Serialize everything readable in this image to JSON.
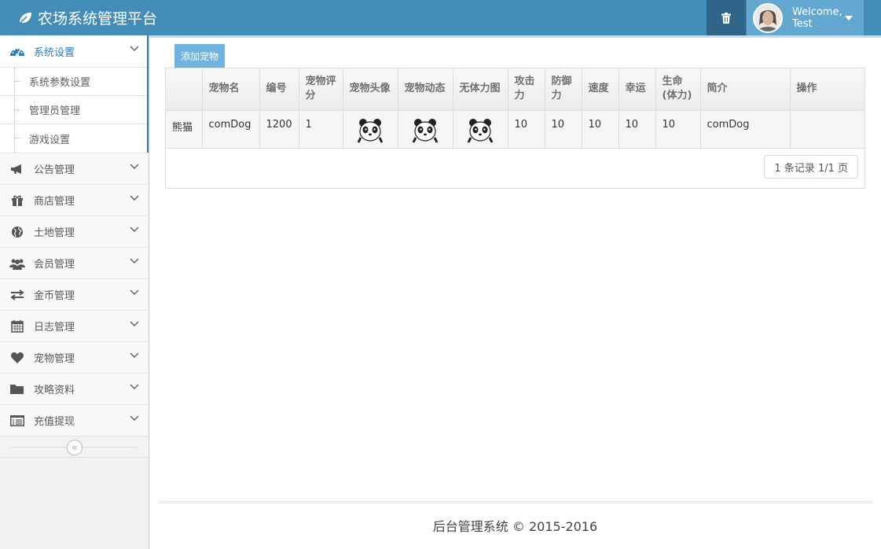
{
  "app": {
    "title": "农场系统管理平台"
  },
  "header": {
    "welcome": "Welcome,",
    "user_name": "Test"
  },
  "sidebar": {
    "items": [
      {
        "label": "系统设置",
        "icon": "dashboard-icon",
        "active": true,
        "children": [
          "系统参数设置",
          "管理员管理",
          "游戏设置"
        ]
      },
      {
        "label": "公告管理",
        "icon": "bullhorn-icon"
      },
      {
        "label": "商店管理",
        "icon": "gift-icon"
      },
      {
        "label": "土地管理",
        "icon": "globe-icon"
      },
      {
        "label": "会员管理",
        "icon": "users-icon"
      },
      {
        "label": "金币管理",
        "icon": "exchange-icon"
      },
      {
        "label": "日志管理",
        "icon": "calendar-icon"
      },
      {
        "label": "宠物管理",
        "icon": "heart-icon"
      },
      {
        "label": "攻略资料",
        "icon": "folder-icon"
      },
      {
        "label": "充值提现",
        "icon": "list-alt-icon"
      }
    ]
  },
  "toolbar": {
    "add_label": "添加宠物"
  },
  "table": {
    "headers": [
      "",
      "宠物名",
      "编号",
      "宠物评分",
      "宠物头像",
      "宠物动态",
      "无体力图",
      "攻击力",
      "防御力",
      "速度",
      "幸运",
      "生命(体力)",
      "简介",
      "操作"
    ],
    "rows": [
      {
        "type": "熊猫",
        "name": "comDog",
        "id": "1200",
        "score": "1",
        "attack": "10",
        "defense": "10",
        "speed": "10",
        "luck": "10",
        "hp": "10",
        "intro": "comDog",
        "ops": ""
      }
    ]
  },
  "pager": {
    "text": "1 条记录 1/1 页"
  },
  "footer": {
    "text": "后台管理系统 © 2015-2016"
  }
}
